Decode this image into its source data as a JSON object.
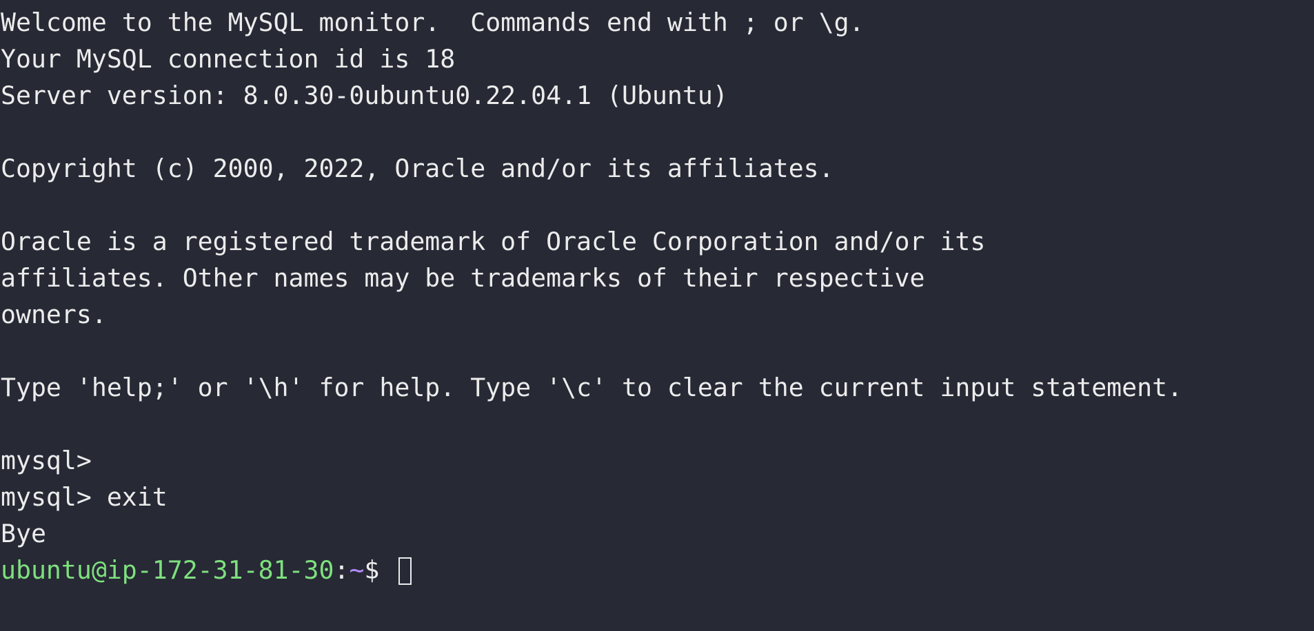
{
  "terminal": {
    "lines": [
      "Welcome to the MySQL monitor.  Commands end with ; or \\g.",
      "Your MySQL connection id is 18",
      "Server version: 8.0.30-0ubuntu0.22.04.1 (Ubuntu)",
      "",
      "Copyright (c) 2000, 2022, Oracle and/or its affiliates.",
      "",
      "Oracle is a registered trademark of Oracle Corporation and/or its",
      "affiliates. Other names may be trademarks of their respective",
      "owners.",
      "",
      "Type 'help;' or '\\h' for help. Type '\\c' to clear the current input statement.",
      "",
      "mysql>",
      "mysql> exit",
      "Bye"
    ],
    "prompt": {
      "user_host": "ubuntu@ip-172-31-81-30",
      "separator": ":",
      "path": "~",
      "symbol": "$ "
    }
  },
  "colors": {
    "background": "#272935",
    "text": "#ececec",
    "prompt_user": "#7ee07e",
    "prompt_path": "#b48cff"
  }
}
